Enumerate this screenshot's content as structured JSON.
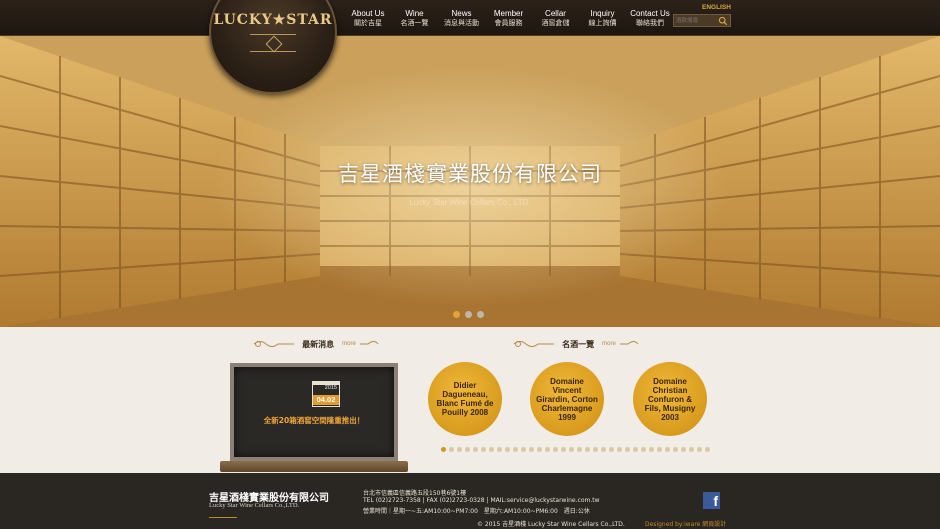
{
  "logo": {
    "text": "LUCKY★STAR"
  },
  "nav": [
    {
      "en": "About Us",
      "zh": "關於吉星"
    },
    {
      "en": "Wine",
      "zh": "名酒一覽"
    },
    {
      "en": "News",
      "zh": "消息與活動"
    },
    {
      "en": "Member",
      "zh": "會員服務"
    },
    {
      "en": "Cellar",
      "zh": "酒窖倉儲"
    },
    {
      "en": "Inquiry",
      "zh": "線上詢價"
    },
    {
      "en": "Contact Us",
      "zh": "聯絡我們"
    }
  ],
  "lang_link": "ENGLISH",
  "search": {
    "placeholder": "酒款搜尋"
  },
  "hero": {
    "title": "吉星酒棧實業股份有限公司",
    "subtitle": "Lucky Star Wine Cellars Co., LTD.",
    "slides_total": 3,
    "active_slide": 1
  },
  "news_section": {
    "title": "最新消息",
    "more": "more",
    "item": {
      "year": "2015",
      "date": "04.02",
      "text": "全新20箱酒窖空間隆重推出！"
    }
  },
  "wine_section": {
    "title": "名酒一覽",
    "more": "more",
    "wines": [
      {
        "name": "Didier Dagueneau, Blanc Fumé de Pouilly 2008"
      },
      {
        "name": "Domaine Vincent Girardin, Corton Charlemagne 1999"
      },
      {
        "name": "Domaine Christian Confuron & Fils, Musigny 2003"
      }
    ],
    "pager_total": 34,
    "pager_active": 1
  },
  "footer": {
    "company_zh": "吉星酒棧實業股份有限公司",
    "company_en": "Lucky Star Wine Cellars Co.,LTD.",
    "address": "台北市信義區信義路五段150巷6號1樓",
    "contact": "TEL (02)2723-7358 | FAX (02)2723-0328 | MAIL:service@luckystarwine.com.tw",
    "hours": "營業時間｜星期一~五:AM10:00~PM7:00　星期六:AM10:00~PM6:00　週日:公休",
    "facebook": "f",
    "copyright": "© 2015 吉星酒棧 Lucky Star Wine Cellars Co.,LTD.",
    "designer": "Designed by:iware 網頁設計"
  },
  "colors": {
    "accent": "#d8951f",
    "header": "#2c2219",
    "footer": "#2a2622"
  }
}
